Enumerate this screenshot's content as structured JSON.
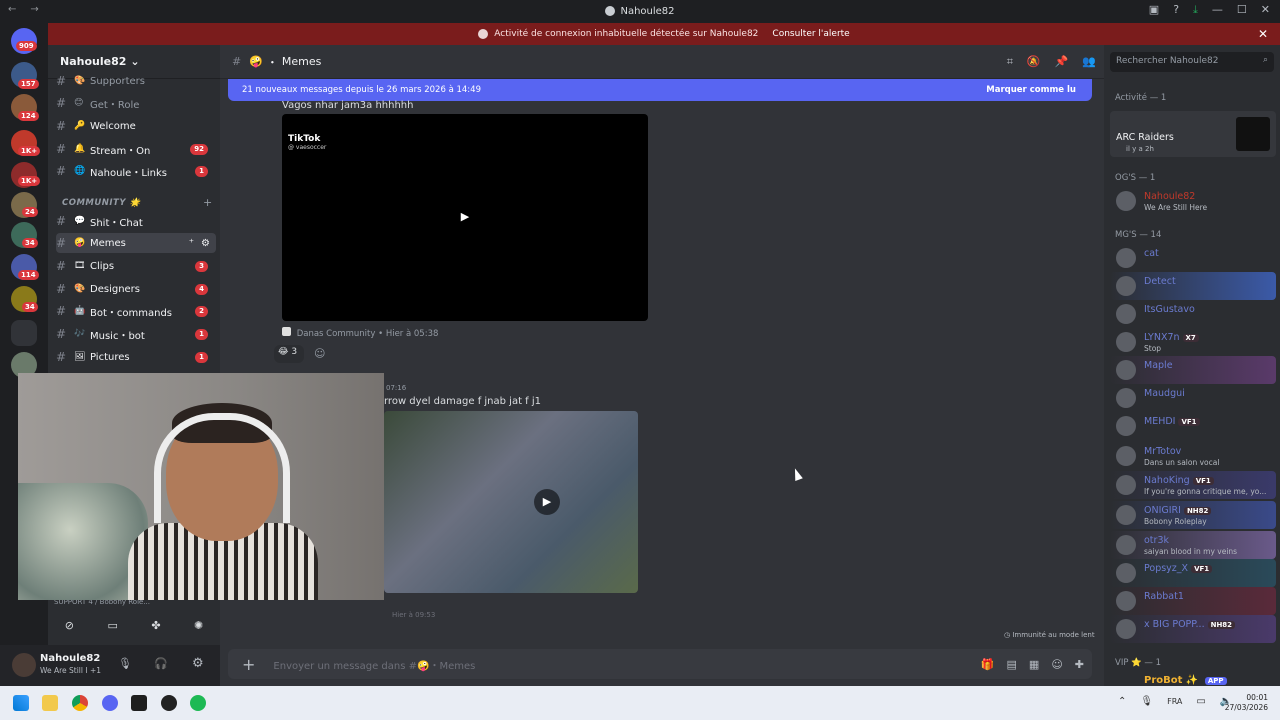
{
  "window": {
    "title": "Nahoule82"
  },
  "alert": {
    "text": "Activité de connexion inhabituelle détectée sur Nahoule82",
    "button": "Consulter l'alerte"
  },
  "servers": {
    "badges": [
      "909",
      "157",
      "124",
      "1K+",
      "1K+",
      "24",
      "34",
      "114",
      "34"
    ]
  },
  "server_header": {
    "name": "Nahoule82"
  },
  "channels": [
    {
      "label": "Supporters",
      "emoji": "🎨"
    },
    {
      "label": "Get・Role",
      "emoji": "😊"
    },
    {
      "label": "Welcome",
      "emoji": "🔑"
    },
    {
      "label": "Stream・On",
      "emoji": "🔔",
      "count": "92"
    },
    {
      "label": "Nahoule・Links",
      "emoji": "🌐",
      "count": "1"
    },
    {
      "label": "Shit・Chat",
      "emoji": "💬"
    },
    {
      "label": "Memes",
      "emoji": "🤪"
    },
    {
      "label": "Clips",
      "emoji": "🎞",
      "count": "3"
    },
    {
      "label": "Designers",
      "emoji": "🎨",
      "count": "4"
    },
    {
      "label": "Bot・commands",
      "emoji": "🤖",
      "count": "2"
    },
    {
      "label": "Music・bot",
      "emoji": "🎶",
      "count": "1"
    },
    {
      "label": "Pictures",
      "emoji": "🖼",
      "count": "1"
    }
  ],
  "category": "COMMUNITY 🌟",
  "voice_status": "SUPPORT 4 / Bobony Role...",
  "user": {
    "name": "Nahoule82",
    "status": "We Are Still I +1"
  },
  "main": {
    "channel": "Memes",
    "new_messages": "21 nouveaux messages depuis le 26 mars 2026 à 14:49",
    "mark_read": "Marquer comme lu",
    "msg1_text": "Vagos nhar jam3a hhhhhh",
    "tiktok_label": "TikTok",
    "tiktok_handle": "@ vaesoccer",
    "forward_source": "Danas Community",
    "forward_time": "Hier à 05:38",
    "reaction_count": "3",
    "msg2_time": "07:16",
    "msg2_text": "rrow dyel damage f jnab jat f j1",
    "next_author_time": "Hier à 09:53",
    "slowmode": "Immunité au mode lent",
    "composer_placeholder": "Envoyer un message dans #🤪・Memes"
  },
  "members": {
    "search_placeholder": "Rechercher Nahoule82",
    "activity_header": "Activité — 1",
    "activity_game": "ARC Raiders",
    "activity_time": "il y a 2h",
    "og_header": "OG'S — 1",
    "og_member": {
      "name": "Nahoule82",
      "status": "We Are Still Here"
    },
    "mg_header": "MG'S — 14",
    "mg_members": [
      {
        "name": "cat",
        "status": ""
      },
      {
        "name": "Detect",
        "status": ""
      },
      {
        "name": "ItsGustavo",
        "status": ""
      },
      {
        "name": "LYNX7n",
        "status": "Stop",
        "tag": "X7"
      },
      {
        "name": "Maple",
        "status": ""
      },
      {
        "name": "Maudgui",
        "status": ""
      },
      {
        "name": "MEHDI",
        "status": "",
        "tag": "VF1"
      },
      {
        "name": "MrTotov",
        "status": "Dans un salon vocal"
      },
      {
        "name": "NahoKing",
        "status": "If you're gonna critique me, yo...",
        "tag": "VF1"
      },
      {
        "name": "ONIGIRI",
        "status": "Bobony Roleplay",
        "tag": "NH82"
      },
      {
        "name": "otr3k",
        "status": "saiyan blood in my veins"
      },
      {
        "name": "Popsyz_X",
        "status": "",
        "tag": "VF1"
      },
      {
        "name": "Rabbat1",
        "status": ""
      },
      {
        "name": "x BIG POPP...",
        "status": "",
        "tag": "NH82"
      }
    ],
    "vip_header": "VIP ⭐ — 1",
    "vip_member": "ProBot ✨",
    "vip_tag": "APP"
  },
  "taskbar": {
    "lang": "FRA",
    "time": "00:01",
    "date": "27/03/2026"
  }
}
